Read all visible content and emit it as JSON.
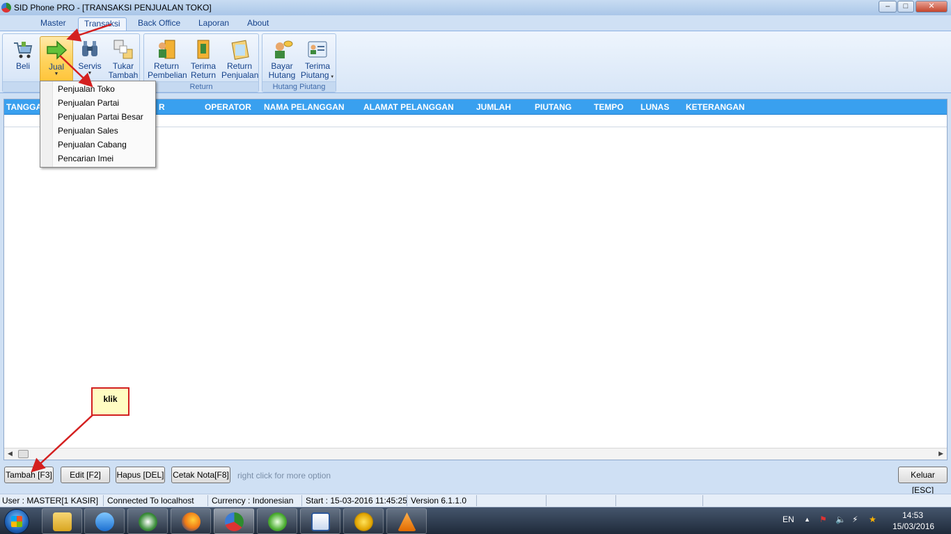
{
  "window": {
    "title": "SID Phone PRO - [TRANSAKSI PENJUALAN TOKO]"
  },
  "menu": {
    "tabs": [
      "Master",
      "Transaksi",
      "Back Office",
      "Laporan",
      "About"
    ],
    "active_tab": "Transaksi"
  },
  "ribbon": {
    "transaksi_buttons": [
      {
        "label": "Beli",
        "icon": "cart-icon"
      },
      {
        "label": "Jual",
        "icon": "green-arrow-icon"
      },
      {
        "label": "Servis",
        "icon": "binoculars-icon"
      },
      {
        "label": "Tukar Tambah",
        "icon": "swap-icon"
      }
    ],
    "return_group_label": "Return",
    "return_buttons": [
      {
        "label": "Return Pembelian",
        "icon": "return-purchase-icon"
      },
      {
        "label": "Terima Return",
        "icon": "receive-return-icon"
      },
      {
        "label": "Return Penjualan",
        "icon": "return-sale-icon"
      }
    ],
    "hutang_group_label": "Hutang Piutang",
    "hutang_buttons": [
      {
        "label": "Bayar Hutang",
        "icon": "pay-debt-icon"
      },
      {
        "label": "Terima Piutang",
        "icon": "receive-credit-icon"
      }
    ]
  },
  "labels": {
    "beli": "Beli",
    "jual": "Jual",
    "servis": "Servis",
    "tukar1": "Tukar",
    "tukar2": "Tambah",
    "rp1": "Return",
    "rp2": "Pembelian",
    "tr1": "Terima",
    "tr2": "Return",
    "rj1": "Return",
    "rj2": "Penjualan",
    "bh1": "Bayar",
    "bh2": "Hutang",
    "tp1": "Terima",
    "tp2": "Piutang"
  },
  "jual_menu": {
    "items": [
      "Penjualan Toko",
      "Penjualan Partai",
      "Penjualan Partai Besar",
      "Penjualan Sales",
      "Penjualan Cabang",
      "Pencarian Imei"
    ]
  },
  "grid": {
    "columns": [
      "TANGGA",
      "R",
      "OPERATOR",
      "NAMA PELANGGAN",
      "ALAMAT PELANGGAN",
      "JUMLAH",
      "PIUTANG",
      "TEMPO",
      "LUNAS",
      "KETERANGAN"
    ],
    "rows": []
  },
  "buttons": {
    "tambah": "Tambah [F3]",
    "edit": "Edit [F2]",
    "hapus": "Hapus [DEL]",
    "cetak": "Cetak Nota[F8]",
    "keluar": "Keluar [ESC]",
    "hint": "right click for more option"
  },
  "annotation": {
    "callout": "klik"
  },
  "status": {
    "user": "User : MASTER[1 KASIR]",
    "connection": "Connected To localhost",
    "currency": "Currency : Indonesian",
    "start": "Start  : 15-03-2016 11:45:25",
    "version": "Version 6.1.1.0"
  },
  "taskbar": {
    "lang": "EN",
    "time": "14:53",
    "date": "15/03/2016"
  }
}
